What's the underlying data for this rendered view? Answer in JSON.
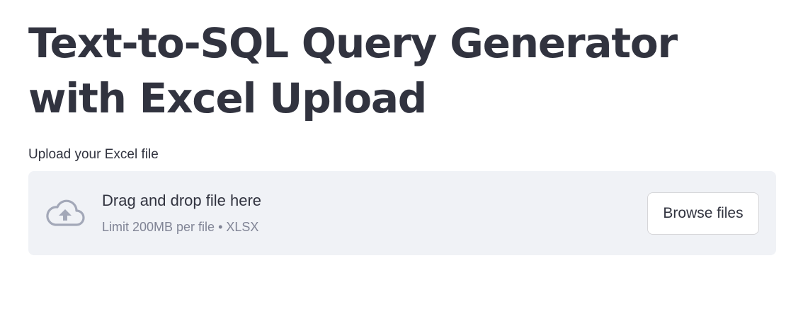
{
  "page": {
    "title": "Text-to-SQL Query Generator with Excel Upload"
  },
  "uploader": {
    "label": "Upload your Excel file",
    "dropzone_title": "Drag and drop file here",
    "limit_text": "Limit 200MB per file • XLSX",
    "browse_label": "Browse files",
    "icon": "cloud-upload-icon"
  },
  "colors": {
    "text": "#31333f",
    "muted": "#808495",
    "dropzone_bg": "#f0f2f6",
    "icon": "#a3a8b8"
  }
}
